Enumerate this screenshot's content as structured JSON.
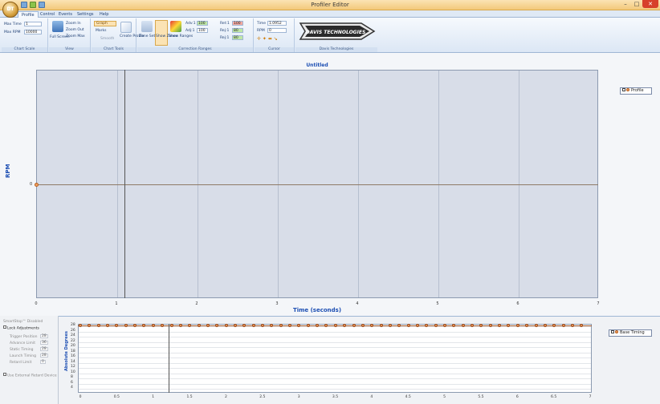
{
  "window": {
    "title": "Profiler Editor",
    "app_orb_text": "DT",
    "controls": [
      "–",
      "□",
      "✕"
    ]
  },
  "tabs": [
    "Profile",
    "Control",
    "Events",
    "Settings",
    "Help"
  ],
  "ribbon": {
    "chart_scale": {
      "label": "Chart Scale",
      "max_time_label": "Max Time",
      "max_time_value": "1",
      "max_rpm_label": "Max RPM",
      "max_rpm_value": "10000"
    },
    "view": {
      "label": "View",
      "full_screen": "Full Screen",
      "zoom_in": "Zoom In",
      "zoom_out": "Zoom Out",
      "zoom_max": "Zoom Max"
    },
    "chart_tools": {
      "label": "Chart Tools",
      "graph_combo": "Graph",
      "marks": "Marks",
      "smooth": "Smooth",
      "create_profile": "Create Profile"
    },
    "correction_ranges": {
      "label": "Correction Ranges",
      "zone_settings": "Zone Settings",
      "show_zones": "Show Zones",
      "show_ranges": "Show Ranges",
      "rows": [
        {
          "a_label": "Adv:1",
          "a_value": "100",
          "b_label": "Ret:1",
          "b_value": "100"
        },
        {
          "a_label": "Adj:1",
          "a_value": "100",
          "b_label": "Rej:1",
          "b_value": "80"
        },
        {
          "a_label": "",
          "a_value": "",
          "b_label": "Rej:1",
          "b_value": "80"
        }
      ]
    },
    "cursor": {
      "label": "Cursor",
      "time_label": "Time",
      "time_value": "1.0952",
      "rpm_label": "RPM",
      "rpm_value": "0"
    },
    "davis": {
      "label": "Davis Technologies",
      "logo_text": "DAVIS TECHNOLOGIES"
    }
  },
  "main_chart": {
    "title": "Untitled",
    "x_title": "Time (seconds)",
    "y_title": "RPM",
    "y_zero_label": "0",
    "legend_label": "Profile"
  },
  "side_panel": {
    "smartstop": "SmartStop™ Disabled",
    "lock_adjustments": "Lock Adjustments",
    "rows": [
      {
        "label": "Trigger Position",
        "value": "28"
      },
      {
        "label": "Advance Limit",
        "value": "36"
      },
      {
        "label": "Static Timing",
        "value": "28"
      },
      {
        "label": "Launch Timing",
        "value": "28"
      },
      {
        "label": "Retard Limit",
        "value": "0"
      }
    ],
    "external_retard": "Use External Retard Device"
  },
  "timing_chart": {
    "y_title": "Absolute Degrees",
    "y_ticks": [
      "28",
      "26",
      "24",
      "22",
      "20",
      "18",
      "16",
      "14",
      "12",
      "10",
      "8",
      "6",
      "4"
    ],
    "legend_label": "Base Timing"
  },
  "chart_data": [
    {
      "type": "line",
      "title": "Untitled",
      "xlabel": "Time (seconds)",
      "ylabel": "RPM",
      "x_ticks": [
        "0",
        "1",
        "2",
        "3",
        "4",
        "5",
        "6",
        "7"
      ],
      "xlim": [
        0,
        7
      ],
      "series": [
        {
          "name": "Profile",
          "x": [
            0,
            7
          ],
          "y": [
            0,
            0
          ]
        }
      ],
      "cursor_x": 1.0952,
      "legend": "right"
    },
    {
      "type": "line",
      "xlabel": "",
      "ylabel": "Absolute Degrees",
      "x_ticks": [
        "0",
        "0.5",
        "1",
        "1.5",
        "2",
        "2.5",
        "3",
        "3.5",
        "4",
        "4.5",
        "5",
        "5.5",
        "6",
        "6.5",
        "7"
      ],
      "xlim": [
        0,
        7
      ],
      "ylim": [
        4,
        28
      ],
      "series": [
        {
          "name": "Base Timing",
          "x": [
            0,
            7
          ],
          "y": [
            28,
            28
          ]
        }
      ],
      "legend": "right"
    }
  ]
}
